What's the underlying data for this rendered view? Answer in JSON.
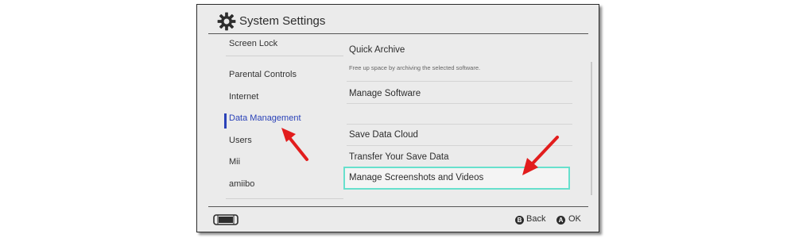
{
  "header": {
    "title": "System Settings",
    "icon": "gear-icon"
  },
  "sidebar": {
    "items": [
      {
        "label": "Screen Lock"
      },
      {
        "label": "Parental Controls"
      },
      {
        "label": "Internet"
      },
      {
        "label": "Data Management",
        "selected": true
      },
      {
        "label": "Users"
      },
      {
        "label": "Mii"
      },
      {
        "label": "amiibo"
      }
    ]
  },
  "main": {
    "items": [
      {
        "label": "Quick Archive",
        "description": "Free up space by archiving the selected software."
      },
      {
        "label": "Manage Software"
      },
      {
        "label": "Save Data Cloud"
      },
      {
        "label": "Transfer Your Save Data"
      },
      {
        "label": "Manage Screenshots and Videos",
        "focused": true
      }
    ]
  },
  "footer": {
    "console_icon": "console-icon",
    "back": {
      "button": "B",
      "label": "Back"
    },
    "ok": {
      "button": "A",
      "label": "OK"
    }
  },
  "colors": {
    "selected_text": "#2a42b8",
    "focus_border": "#67e0cd",
    "annotation_arrow": "#e21d1d",
    "panel_background": "#ebebeb"
  }
}
